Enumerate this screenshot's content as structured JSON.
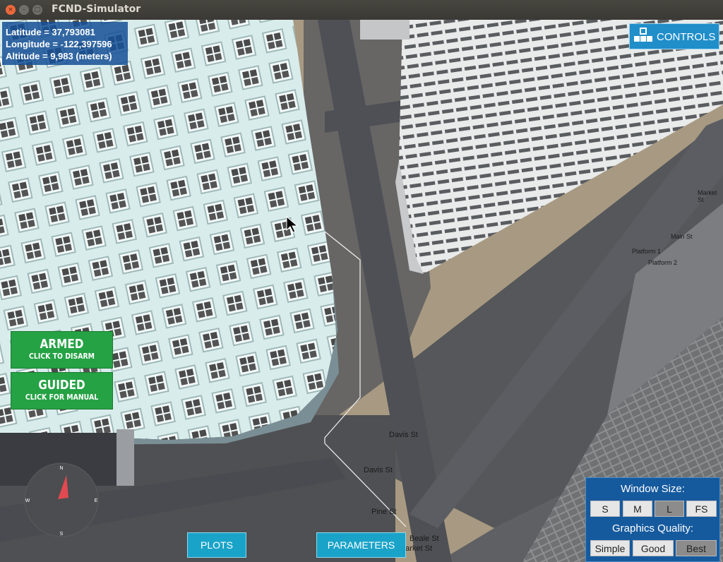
{
  "window": {
    "title": "FCND-Simulator",
    "close": "×",
    "minimize": "–",
    "maximize": "□"
  },
  "coords": {
    "latitude": "Latitude = 37,793081",
    "longitude": "Longitude = -122,397596",
    "altitude": "Altitude = 9,983 (meters)"
  },
  "controls": {
    "label": "CONTROLS"
  },
  "status": {
    "armed_title": "ARMED",
    "armed_sub": "CLICK TO DISARM",
    "guided_title": "GUIDED",
    "guided_sub": "CLICK FOR MANUAL"
  },
  "compass": {
    "n": "N",
    "s": "S",
    "e": "E",
    "w": "W"
  },
  "bottom": {
    "plots": "PLOTS",
    "parameters": "PARAMETERS"
  },
  "settings": {
    "window_size_label": "Window Size:",
    "window_sizes": [
      "S",
      "M",
      "L",
      "FS"
    ],
    "window_size_selected": "L",
    "graphics_label": "Graphics Quality:",
    "graphics": [
      "Simple",
      "Good",
      "Best"
    ],
    "graphics_selected": "Best"
  },
  "streets": {
    "davis1": "Davis St",
    "davis2": "Davis St",
    "pine": "Pine St",
    "beale": "Beale St",
    "market_bottom": "Market St",
    "market_right": "Market St",
    "main": "Main St",
    "platform1": "Platform 1",
    "platform2": "Platform 2"
  },
  "colors": {
    "armed": "#25a244",
    "panel": "#165a9e",
    "button": "#1aa3c9"
  }
}
